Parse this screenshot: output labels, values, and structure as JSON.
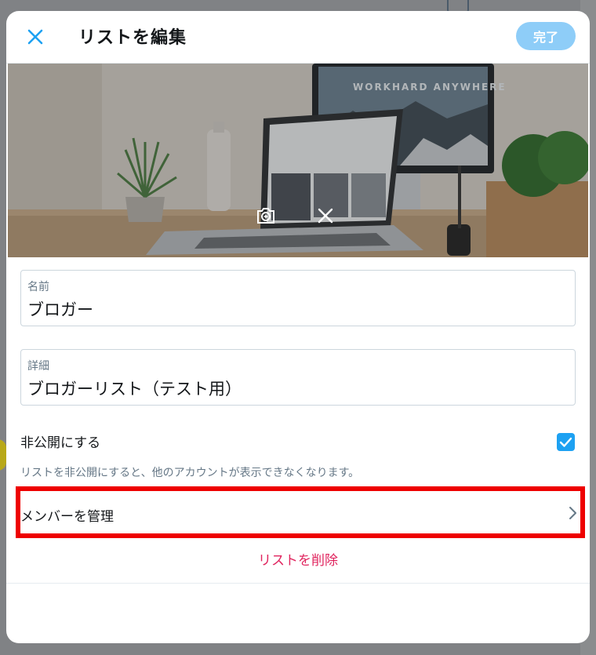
{
  "dialog": {
    "title": "リストを編集",
    "close_icon": "close-icon",
    "done_label": "完了",
    "accent_color": "#1da1f2",
    "danger_color": "#e0245e"
  },
  "banner": {
    "image": "desk-laptop-photo",
    "monitor_text": "WORKHARD ANYWHERE",
    "add_photo_icon": "camera-plus-icon",
    "remove_icon": "close-icon"
  },
  "form": {
    "name": {
      "label": "名前",
      "value": "ブロガー"
    },
    "description": {
      "label": "詳細",
      "value": "ブロガーリスト（テスト用）"
    },
    "private": {
      "label": "非公開にする",
      "checked": true,
      "description": "リストを非公開にすると、他のアカウントが表示できなくなります。"
    }
  },
  "actions": {
    "manage_members": "メンバーを管理",
    "delete_list": "リストを削除"
  }
}
